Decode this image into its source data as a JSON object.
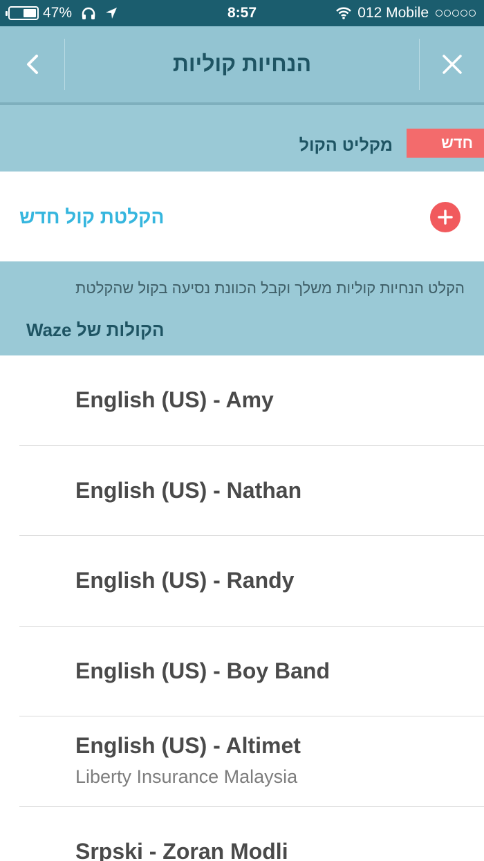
{
  "status_bar": {
    "battery": "47%",
    "battery_level": 0.47,
    "time": "8:57",
    "carrier": "012 Mobile"
  },
  "nav": {
    "title": "הנחיות קוליות",
    "back_icon": "chevron-left-icon",
    "close_icon": "close-icon"
  },
  "recorder": {
    "new_badge": "חדש",
    "title": "מקליט הקול"
  },
  "record_new": {
    "label": "הקלטת קול חדש",
    "icon": "plus-icon"
  },
  "info": {
    "description": "הקלט הנחיות קוליות משלך וקבל הכוונת נסיעה בקול שהקלטת",
    "waze_heading": "הקולות של Waze"
  },
  "voices": [
    {
      "name": "English (US) - Amy",
      "subtitle": ""
    },
    {
      "name": "English (US) - Nathan",
      "subtitle": ""
    },
    {
      "name": "English (US) - Randy",
      "subtitle": ""
    },
    {
      "name": "English (US) - Boy Band",
      "subtitle": ""
    },
    {
      "name": "English (US) - Altimet",
      "subtitle": "Liberty Insurance Malaysia"
    },
    {
      "name": "Srpski - Zoran Modli",
      "subtitle": ""
    }
  ],
  "colors": {
    "status_bar": "#1b5d6e",
    "nav_bar": "#93c4d2",
    "accent_red": "#f15a5d",
    "accent_blue": "#36b6de"
  }
}
